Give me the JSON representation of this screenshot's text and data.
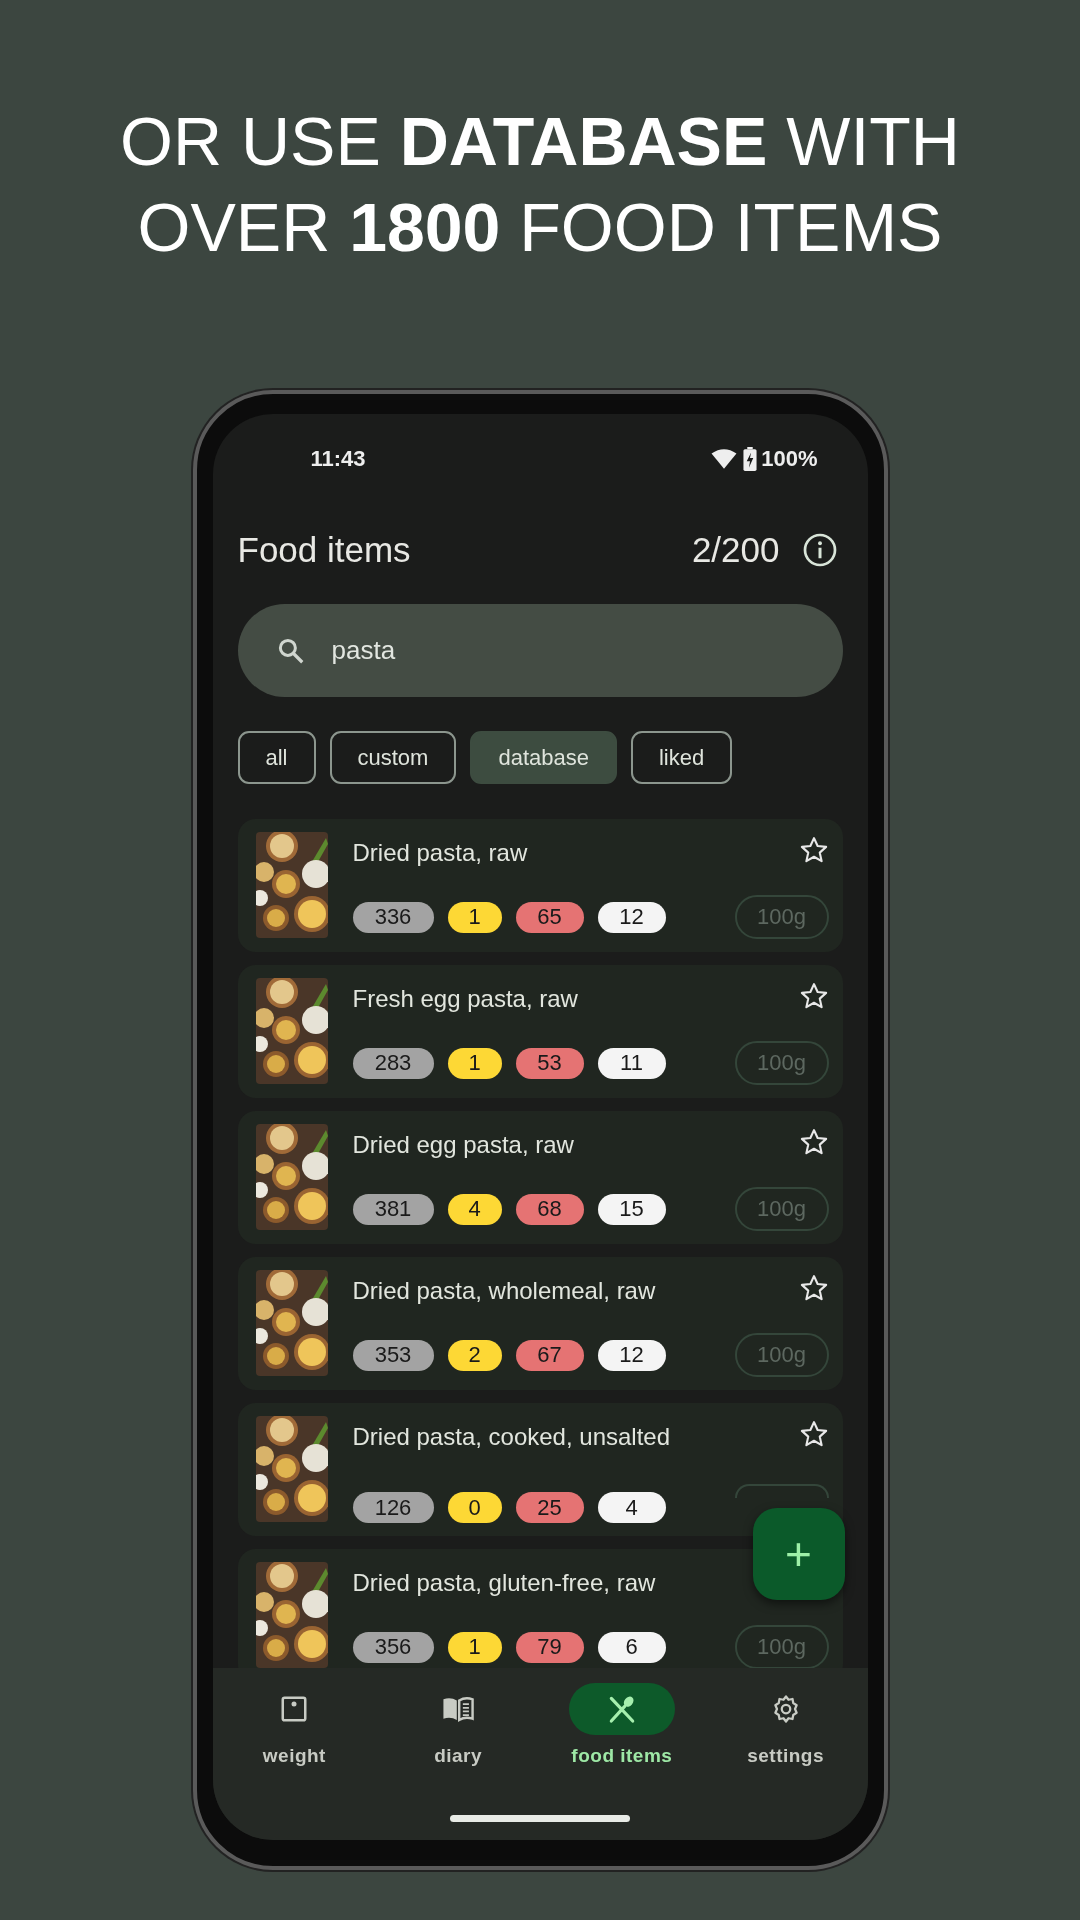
{
  "headline": [
    "OR USE **DATABASE** WITH",
    "OVER **1800** FOOD ITEMS"
  ],
  "status_bar": {
    "time": "11:43",
    "battery": "100%"
  },
  "header": {
    "title": "Food items",
    "count": "2/200"
  },
  "search": {
    "value": "pasta"
  },
  "filters": [
    {
      "label": "all",
      "selected": false
    },
    {
      "label": "custom",
      "selected": false
    },
    {
      "label": "database",
      "selected": true
    },
    {
      "label": "liked",
      "selected": false
    }
  ],
  "items": [
    {
      "name": "Dried pasta, raw",
      "macros": [
        "336",
        "1",
        "65",
        "12"
      ],
      "portion": "100g",
      "liked": false
    },
    {
      "name": "Fresh egg pasta, raw",
      "macros": [
        "283",
        "1",
        "53",
        "11"
      ],
      "portion": "100g",
      "liked": false
    },
    {
      "name": "Dried egg pasta, raw",
      "macros": [
        "381",
        "4",
        "68",
        "15"
      ],
      "portion": "100g",
      "liked": false
    },
    {
      "name": "Dried pasta, wholemeal, raw",
      "macros": [
        "353",
        "2",
        "67",
        "12"
      ],
      "portion": "100g",
      "liked": false
    },
    {
      "name": "Dried pasta, cooked, unsalted",
      "macros": [
        "126",
        "0",
        "25",
        "4"
      ],
      "liked": false
    },
    {
      "name": "Dried pasta, gluten-free, raw",
      "macros": [
        "356",
        "1",
        "79",
        "6"
      ],
      "portion": "100g"
    }
  ],
  "fab": {
    "label": "+"
  },
  "nav": [
    {
      "label": "weight",
      "selected": false
    },
    {
      "label": "diary",
      "selected": false
    },
    {
      "label": "food items",
      "selected": true
    },
    {
      "label": "settings",
      "selected": false
    }
  ]
}
